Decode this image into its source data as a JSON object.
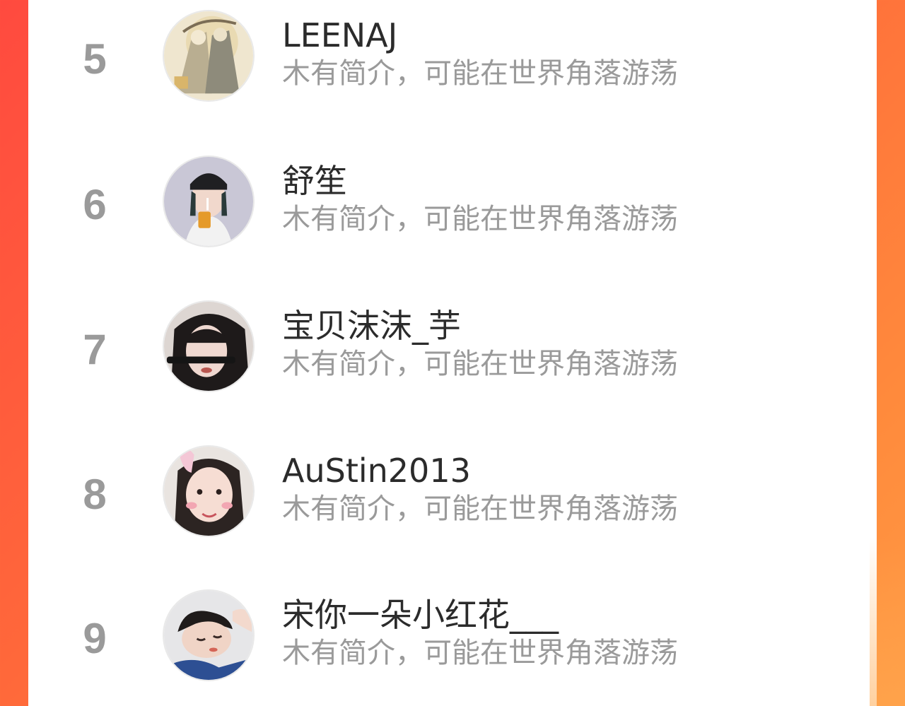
{
  "colors": {
    "background_start": "#ff4a3f",
    "background_end": "#ff9a44",
    "panel": "#ffffff",
    "rank_text": "#9a9a9a",
    "name_text": "#2b2b2b",
    "bio_text": "#9a9a9a"
  },
  "ranking": {
    "rows": [
      {
        "rank": "5",
        "name": "LEENAJ",
        "bio": "木有简介，可能在世界角落游荡",
        "avatar_icon": "avatar-illustration-pair-icon"
      },
      {
        "rank": "6",
        "name": "舒笙",
        "bio": "木有简介，可能在世界角落游荡",
        "avatar_icon": "avatar-girl-with-cap-icon"
      },
      {
        "rank": "7",
        "name": "宝贝沫沫_芋",
        "bio": "木有简介，可能在世界角落游荡",
        "avatar_icon": "avatar-girl-sunglasses-icon"
      },
      {
        "rank": "8",
        "name": "AuStin2013",
        "bio": "木有简介，可能在世界角落游荡",
        "avatar_icon": "avatar-girl-bunny-ears-icon"
      },
      {
        "rank": "9",
        "name": "宋你一朵小红花___",
        "bio": "木有简介，可能在世界角落游荡",
        "avatar_icon": "avatar-sleeping-person-icon"
      }
    ]
  }
}
